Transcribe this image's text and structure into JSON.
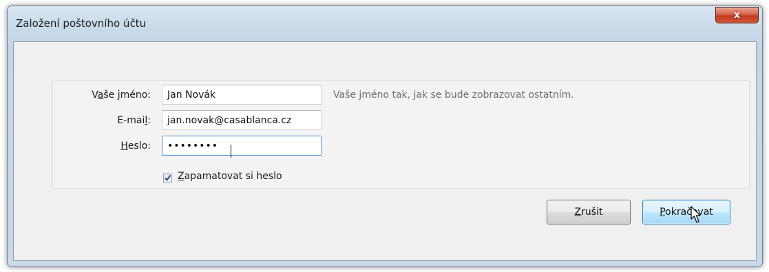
{
  "window": {
    "title": "Založení poštovního účtu",
    "close_label": "x"
  },
  "form": {
    "name": {
      "label_prefix": "V",
      "label_accel": "a",
      "label_rest": "še jméno:",
      "value": "Jan Novák",
      "hint": "Vaše jméno tak, jak se bude zobrazovat ostatním."
    },
    "email": {
      "label_prefix": "E-mai",
      "label_accel": "l",
      "label_rest": ":",
      "value": "jan.novak@casablanca.cz"
    },
    "password": {
      "label_prefix": "",
      "label_accel": "H",
      "label_rest": "eslo:",
      "value": "••••••••"
    },
    "remember": {
      "checked": true,
      "label_accel": "Z",
      "label_rest": "apamatovat si heslo"
    }
  },
  "buttons": {
    "cancel": {
      "accel": "Z",
      "rest": "rušit"
    },
    "continue": {
      "accel": "P",
      "rest": "okračovat"
    }
  },
  "colors": {
    "accent": "#3c7fb1",
    "close": "#c23a1f"
  }
}
